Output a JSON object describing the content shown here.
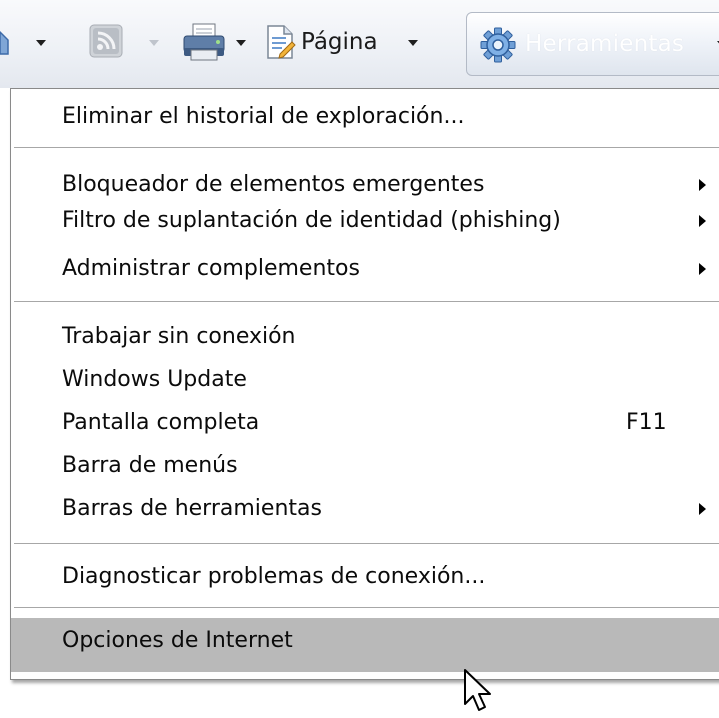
{
  "toolbar": {
    "page_label": "Página",
    "tools_label": "Herramientas",
    "icons": [
      "home-icon",
      "feed-icon",
      "print-icon",
      "page-icon",
      "gear-icon"
    ]
  },
  "menu": {
    "items": [
      {
        "label": "Eliminar el historial de exploración..."
      },
      {
        "label": "Bloqueador de elementos emergentes",
        "submenu": true
      },
      {
        "label": "Filtro de suplantación de identidad (phishing)",
        "submenu": true
      },
      {
        "label": "Administrar complementos",
        "submenu": true
      },
      {
        "label": "Trabajar sin conexión"
      },
      {
        "label": "Windows Update"
      },
      {
        "label": "Pantalla completa",
        "shortcut": "F11"
      },
      {
        "label": "Barra de menús"
      },
      {
        "label": "Barras de herramientas",
        "submenu": true
      },
      {
        "label": "Diagnosticar problemas de conexión..."
      },
      {
        "label": "Opciones de Internet",
        "highlighted": true
      }
    ]
  },
  "colors": {
    "highlight": "#b9b9b9",
    "menu_text": "#0b0b0b",
    "toolbar_bg": "#eef1f6"
  }
}
